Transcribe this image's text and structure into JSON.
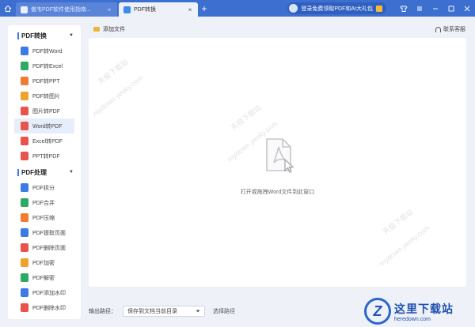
{
  "titlebar": {
    "tabs": [
      {
        "label": "傲韦PDF软件使用指南...",
        "active": false
      },
      {
        "label": "PDF转换",
        "active": true
      }
    ],
    "promo_label": "登录免费领取PDF和AI大礼包",
    "close_glyph": "×",
    "add_glyph": "+"
  },
  "sidebar": {
    "sections": [
      {
        "title": "PDF转换",
        "items": [
          {
            "label": "PDF转Word",
            "color": "#3b7be8"
          },
          {
            "label": "PDF转Excel",
            "color": "#2eaa62"
          },
          {
            "label": "PDF转PPT",
            "color": "#ef7d33"
          },
          {
            "label": "PDF转图片",
            "color": "#f0a22f"
          },
          {
            "label": "图片转PDF",
            "color": "#e9534b"
          },
          {
            "label": "Word转PDF",
            "color": "#e9534b"
          },
          {
            "label": "Excel转PDF",
            "color": "#e9534b"
          },
          {
            "label": "PPT转PDF",
            "color": "#e9534b"
          }
        ]
      },
      {
        "title": "PDF处理",
        "items": [
          {
            "label": "PDF拆分",
            "color": "#3b7be8"
          },
          {
            "label": "PDF合并",
            "color": "#2eaa62"
          },
          {
            "label": "PDF压缩",
            "color": "#ef7d33"
          },
          {
            "label": "PDF提取页面",
            "color": "#3b7be8"
          },
          {
            "label": "PDF删除页面",
            "color": "#e9534b"
          },
          {
            "label": "PDF加密",
            "color": "#f0a22f"
          },
          {
            "label": "PDF解密",
            "color": "#2eaa62"
          },
          {
            "label": "PDF添加水印",
            "color": "#3b7be8"
          },
          {
            "label": "PDF删除水印",
            "color": "#e9534b"
          }
        ]
      }
    ],
    "selected": "Word转PDF"
  },
  "main": {
    "add_file_label": "添加文件",
    "service_label": "联系客服",
    "drop_text": "打开或拖拽Word文件到此窗口"
  },
  "footer": {
    "output_label": "输出路径：",
    "output_value": "保存到文档当前目录",
    "choose_label": "选择路径"
  },
  "watermark": {
    "cn": "天极下载站",
    "en": "mydown.yesky.com"
  },
  "logo": {
    "mark": "Z",
    "cn": "这里下载站",
    "en": "heredown.com"
  }
}
